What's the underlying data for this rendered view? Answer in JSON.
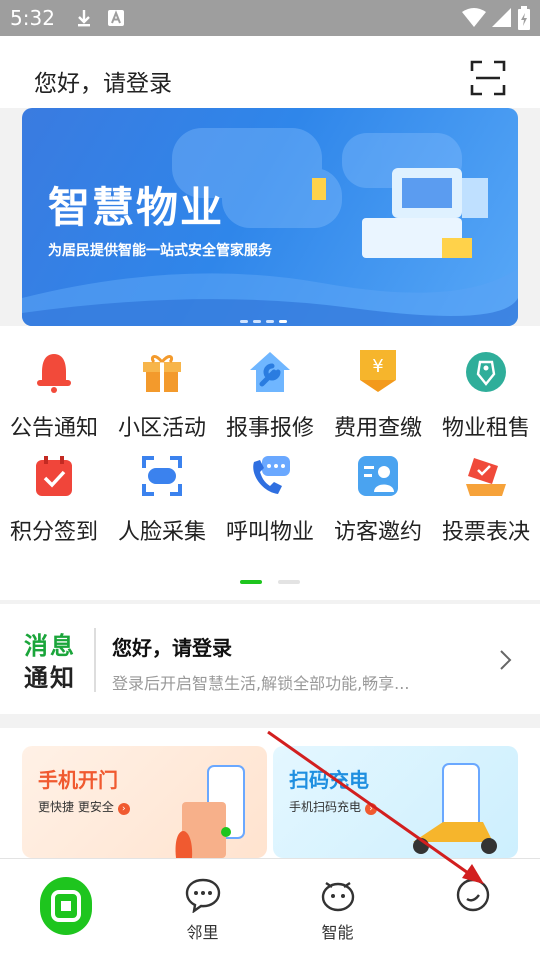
{
  "status_bar": {
    "time": "5:32"
  },
  "header": {
    "greeting": "您好，请登录"
  },
  "banner": {
    "title": "智慧物业",
    "subtitle": "为居民提供智能一站式安全管家服务"
  },
  "services": {
    "row1": [
      {
        "label": "公告通知",
        "icon": "bell-icon"
      },
      {
        "label": "小区活动",
        "icon": "gift-icon"
      },
      {
        "label": "报事报修",
        "icon": "wrench-house-icon"
      },
      {
        "label": "费用查缴",
        "icon": "yuan-icon"
      },
      {
        "label": "物业租售",
        "icon": "tag-icon"
      }
    ],
    "row2": [
      {
        "label": "积分签到",
        "icon": "calendar-check-icon"
      },
      {
        "label": "人脸采集",
        "icon": "face-scan-icon"
      },
      {
        "label": "呼叫物业",
        "icon": "phone-icon"
      },
      {
        "label": "访客邀约",
        "icon": "visitor-icon"
      },
      {
        "label": "投票表决",
        "icon": "vote-icon"
      }
    ]
  },
  "notice": {
    "logo_line1": "消息",
    "logo_line2": "通知",
    "title": "您好，请登录",
    "description": "登录后开启智慧生活,解锁全部功能,畅享..."
  },
  "cards": [
    {
      "title": "手机开门",
      "subtitle": "更快捷 更安全",
      "color": "#f05a30"
    },
    {
      "title": "扫码充电",
      "subtitle": "手机扫码充电",
      "color": "#1f8fe0"
    }
  ],
  "tabbar": {
    "tabs": [
      {
        "label": ""
      },
      {
        "label": "邻里"
      },
      {
        "label": "智能"
      },
      {
        "label": ""
      }
    ]
  },
  "colors": {
    "brand_green": "#1ec51e",
    "banner_blue": "#2f86ea"
  }
}
